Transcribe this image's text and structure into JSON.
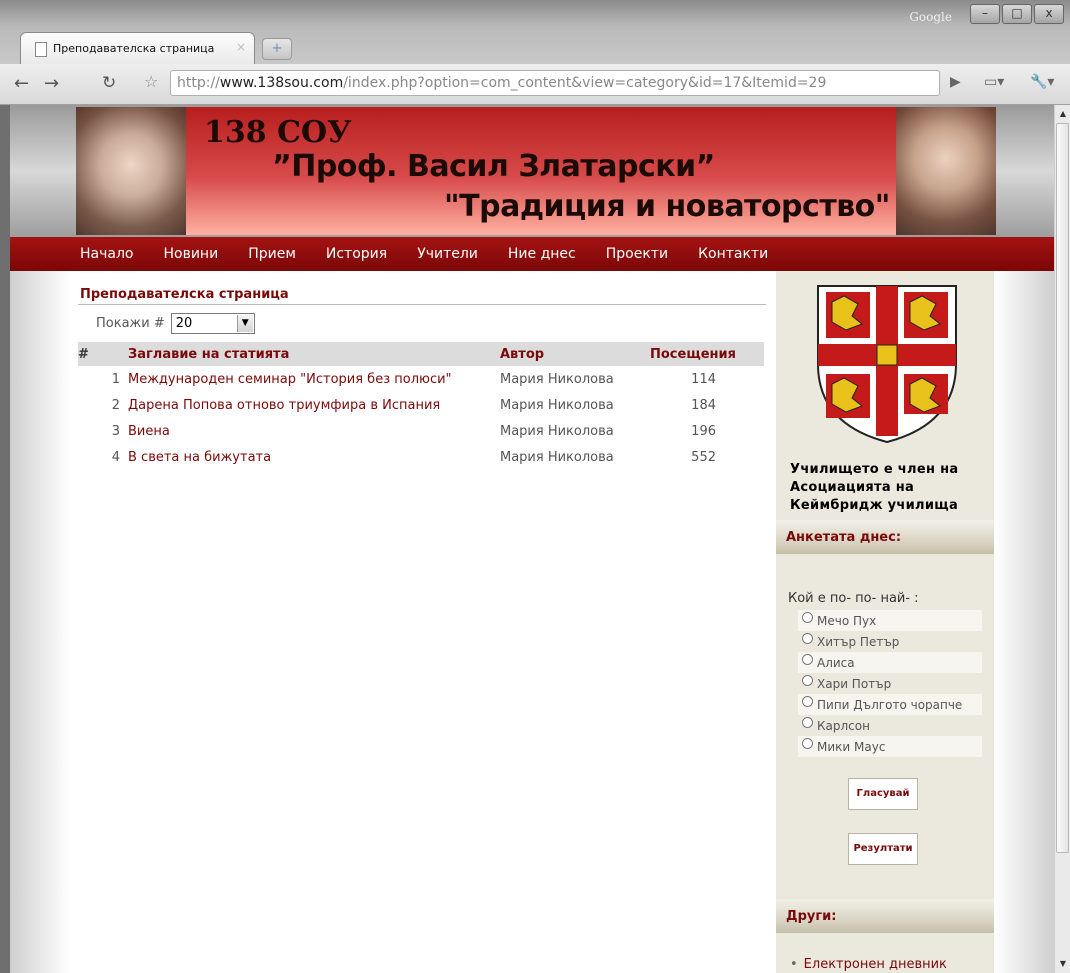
{
  "browser": {
    "search_brand": "Google",
    "tab_title": "Преподавателска страница",
    "tab_close": "×",
    "new_tab": "+",
    "url_prefix": "http://",
    "url_host": "www.138sou.com",
    "url_path": "/index.php?option=com_content&view=category&id=17&Itemid=29"
  },
  "banner": {
    "line1": "138 СОУ",
    "line2": "”Проф. Васил Златарски”",
    "line3": "\"Традиция и новаторство\""
  },
  "menu": [
    "Начало",
    "Новини",
    "Прием",
    "История",
    "Учители",
    "Ние днес",
    "Проекти",
    "Контакти"
  ],
  "content": {
    "category_title": "Преподавателска страница",
    "display_label": "Покажи #",
    "display_value": "20",
    "headers": {
      "num": "#",
      "title": "Заглавие на статията",
      "author": "Автор",
      "hits": "Посещения"
    },
    "articles": [
      {
        "num": "1",
        "title": "Международен семинар \"История без полюси\"",
        "author": "Мария Николова",
        "hits": "114"
      },
      {
        "num": "2",
        "title": "Дарена Попова отново триумфира в Испания",
        "author": "Мария Николова",
        "hits": "184"
      },
      {
        "num": "3",
        "title": "Виена",
        "author": "Мария Николова",
        "hits": "196"
      },
      {
        "num": "4",
        "title": "В света на бижутата",
        "author": "Мария Николова",
        "hits": "552"
      }
    ]
  },
  "sidebar": {
    "cambridge_text": "Училището е член на Асоциацията на Кеймбридж училища",
    "poll_title": "Анкетата днес:",
    "poll_question": "Кой е по- по- най- :",
    "poll_options": [
      "Мечо Пух",
      "Хитър Петър",
      "Алиса",
      "Хари Потър",
      "Пипи Дългото чорапче",
      "Карлсон",
      "Мики Маус"
    ],
    "vote_button": "Гласувай",
    "results_button": "Резултати",
    "others_title": "Други:",
    "others_items": [
      "Електронен дневник"
    ]
  },
  "colors": {
    "menu_bar": "#8f0c0c",
    "link": "#7a0a0a",
    "sidebar_bg": "#ebe8de"
  }
}
